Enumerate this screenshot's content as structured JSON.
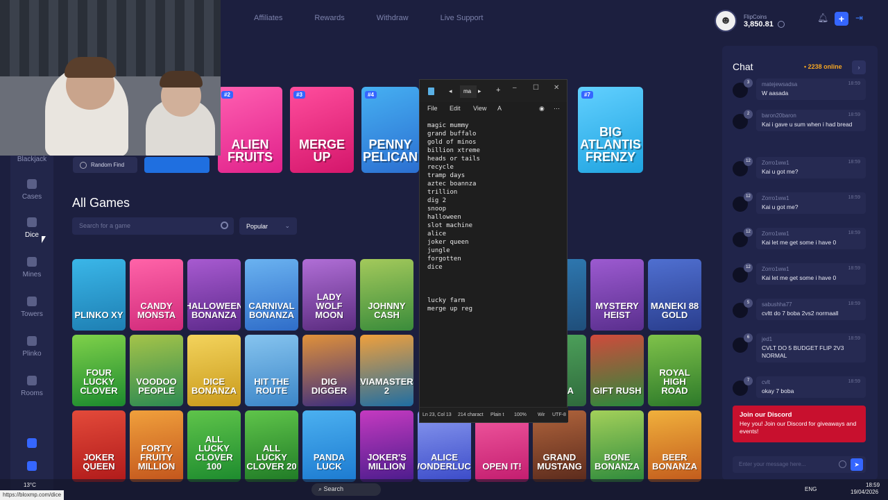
{
  "topnav": [
    "Affiliates",
    "Rewards",
    "Withdraw",
    "Live Support"
  ],
  "wallet": {
    "label": "FlipCoins",
    "amount": "3,850.81"
  },
  "sidebar": [
    {
      "label": "Blackjack"
    },
    {
      "label": "Cases"
    },
    {
      "label": "Dice"
    },
    {
      "label": "Mines"
    },
    {
      "label": "Towers"
    },
    {
      "label": "Plinko"
    },
    {
      "label": "Rooms"
    }
  ],
  "random_find": "Random Find",
  "featured": [
    {
      "rank": "#2",
      "title": "ALIEN FRUITS",
      "color": "#e0218a",
      "color2": "#ff5fb1"
    },
    {
      "rank": "#3",
      "title": "MERGE UP",
      "color": "#d4166b",
      "color2": "#ff4d9d"
    },
    {
      "rank": "#4",
      "title": "PENNY PELICAN",
      "color": "#2b6fd1",
      "color2": "#46b0f2"
    },
    {
      "rank": "#7",
      "title": "BIG ATLANTIS FRENZY",
      "color": "#1fa3e0",
      "color2": "#62d0ff"
    }
  ],
  "all_games": {
    "heading": "All Games",
    "search_placeholder": "Search for a game",
    "sort": "Popular"
  },
  "games": [
    [
      {
        "t": "PLINKO XY",
        "c": "#1e7fb3",
        "c2": "#3ab6e8"
      },
      {
        "t": "CANDY MONSTA",
        "c": "#d12b7b",
        "c2": "#ff63a8"
      },
      {
        "t": "HALLOWEEN BONANZA",
        "c": "#5e2a8c",
        "c2": "#a75ad0"
      },
      {
        "t": "CARNIVAL BONANZA",
        "c": "#2f6dc9",
        "c2": "#6ab2f0"
      },
      {
        "t": "LADY WOLF MOON",
        "c": "#5b2c80",
        "c2": "#b06ed6"
      },
      {
        "t": "JOHNNY CASH",
        "c": "#3a8c3b",
        "c2": "#a3c95b"
      },
      {
        "t": "",
        "c": "#6a1c1c",
        "c2": "#a22c2c"
      },
      {
        "t": "",
        "c": "#2b5a52",
        "c2": "#3d7d70"
      },
      {
        "t": "",
        "c": "#1f4e7a",
        "c2": "#2f7ab3"
      },
      {
        "t": "MYSTERY HEIST",
        "c": "#5a2f8e",
        "c2": "#9c5ad0"
      },
      {
        "t": "MANEKI 88 GOLD",
        "c": "#2a3e8e",
        "c2": "#4f6fd0"
      }
    ],
    [
      {
        "t": "FOUR LUCKY CLOVER",
        "c": "#1c8a2e",
        "c2": "#7fd14a"
      },
      {
        "t": "VOODOO PEOPLE",
        "c": "#2d8a52",
        "c2": "#a5c449"
      },
      {
        "t": "DICE BONANZA",
        "c": "#c99a1c",
        "c2": "#f3d35c"
      },
      {
        "t": "HIT THE ROUTE",
        "c": "#3c86c8",
        "c2": "#86c4ef"
      },
      {
        "t": "DIG DIGGER",
        "c": "#3f2f7d",
        "c2": "#e0913a"
      },
      {
        "t": "AVIAMASTERS 2",
        "c": "#1f6ea3",
        "c2": "#f0a03c"
      },
      {
        "t": "",
        "c": "#1d5a44",
        "c2": "#2f8a68"
      },
      {
        "t": "",
        "c": "#205a86",
        "c2": "#3a86c0"
      },
      {
        "t": "H NDA",
        "c": "#2f6b3c",
        "c2": "#4ea35c"
      },
      {
        "t": "GIFT RUSH",
        "c": "#2a8a3c",
        "c2": "#d04a3c"
      },
      {
        "t": "ROYAL HIGH ROAD",
        "c": "#2d7a2a",
        "c2": "#7fc24a"
      }
    ],
    [
      {
        "t": "JOKER QUEEN",
        "c": "#b01a1a",
        "c2": "#e34a3a"
      },
      {
        "t": "FORTY FRUITY MILLION",
        "c": "#c2541c",
        "c2": "#f0a03c"
      },
      {
        "t": "ALL LUCKY CLOVER 100",
        "c": "#1c8a2e",
        "c2": "#5fc44a"
      },
      {
        "t": "ALL LUCKY CLOVER 20",
        "c": "#1f7a26",
        "c2": "#5fc44a"
      },
      {
        "t": "PANDA LUCK",
        "c": "#1c7ad0",
        "c2": "#4bb0f0"
      },
      {
        "t": "JOKER'S MILLION",
        "c": "#4a1c8c",
        "c2": "#c43ac0"
      },
      {
        "t": "ALICE WONDERLUCK",
        "c": "#3a4ac8",
        "c2": "#8a9af0"
      },
      {
        "t": "OPEN IT!",
        "c": "#c21c6e",
        "c2": "#f25aa0"
      },
      {
        "t": "GRAND MUSTANG",
        "c": "#5a2a1c",
        "c2": "#b0643c"
      },
      {
        "t": "BONE BONANZA",
        "c": "#2d8a3c",
        "c2": "#a3d05a"
      },
      {
        "t": "BEER BONANZA",
        "c": "#c25a1c",
        "c2": "#f0b03c"
      }
    ]
  ],
  "notepad": {
    "tab": "ma",
    "menu": [
      "File",
      "Edit",
      "View"
    ],
    "text": "magic mummy\ngrand buffalo\ngold of minos\nbillion xtreme\nheads or tails\nrecycle\ntramp days\naztec boannza\ntrillion\ndig 2\nsnoop\nhalloween\nslot machine\nalice\njoker queen\njungle\nforgotten\ndice\n\n\n\nlucky farm\nmerge up reg",
    "status": {
      "pos": "Ln 23, Col 13",
      "chars": "214 charact",
      "type": "Plain t",
      "zoom": "100%",
      "eol": "Wir",
      "enc": "UTF-8"
    }
  },
  "chat": {
    "title": "Chat",
    "online": "2238 online",
    "messages": [
      {
        "name": "matejewsadsa",
        "level": "3",
        "time": "18:59",
        "text": "W aasada"
      },
      {
        "name": "baron20baron",
        "level": "2",
        "time": "18:59",
        "text": "Kai i gave u sum when i had bread"
      },
      {
        "name": "Zorro1ww1",
        "level": "12",
        "time": "18:59",
        "text": "Kai u got me?"
      },
      {
        "name": "Zorro1ww1",
        "level": "12",
        "time": "18:59",
        "text": "Kai u got me?"
      },
      {
        "name": "Zorro1ww1",
        "level": "12",
        "time": "18:59",
        "text": "Kai let me get some i have 0"
      },
      {
        "name": "Zorro1ww1",
        "level": "12",
        "time": "18:59",
        "text": "Kai let me get some i have 0"
      },
      {
        "name": "sabushha77",
        "level": "5",
        "time": "18:59",
        "text": "cvltt do 7 boba 2vs2 normaall"
      },
      {
        "name": "jed1",
        "level": "6",
        "time": "18:59",
        "text": "CVLT DO 5 BUDGET FLIP 2V3 NORMAL"
      },
      {
        "name": "cvlt",
        "level": "7",
        "time": "18:59",
        "text": "okay 7 boba"
      }
    ],
    "discord_title": "Join our Discord",
    "discord_text": "Hey you! Join our Discord for giveaways and events!",
    "input_placeholder": "Enter your message here..."
  },
  "taskbar": {
    "search": "Search",
    "weather": "13°C",
    "lang": "ENG",
    "time": "18:59",
    "date": "19/04/2026"
  },
  "status_url": "https://bloxmp.com/dice"
}
